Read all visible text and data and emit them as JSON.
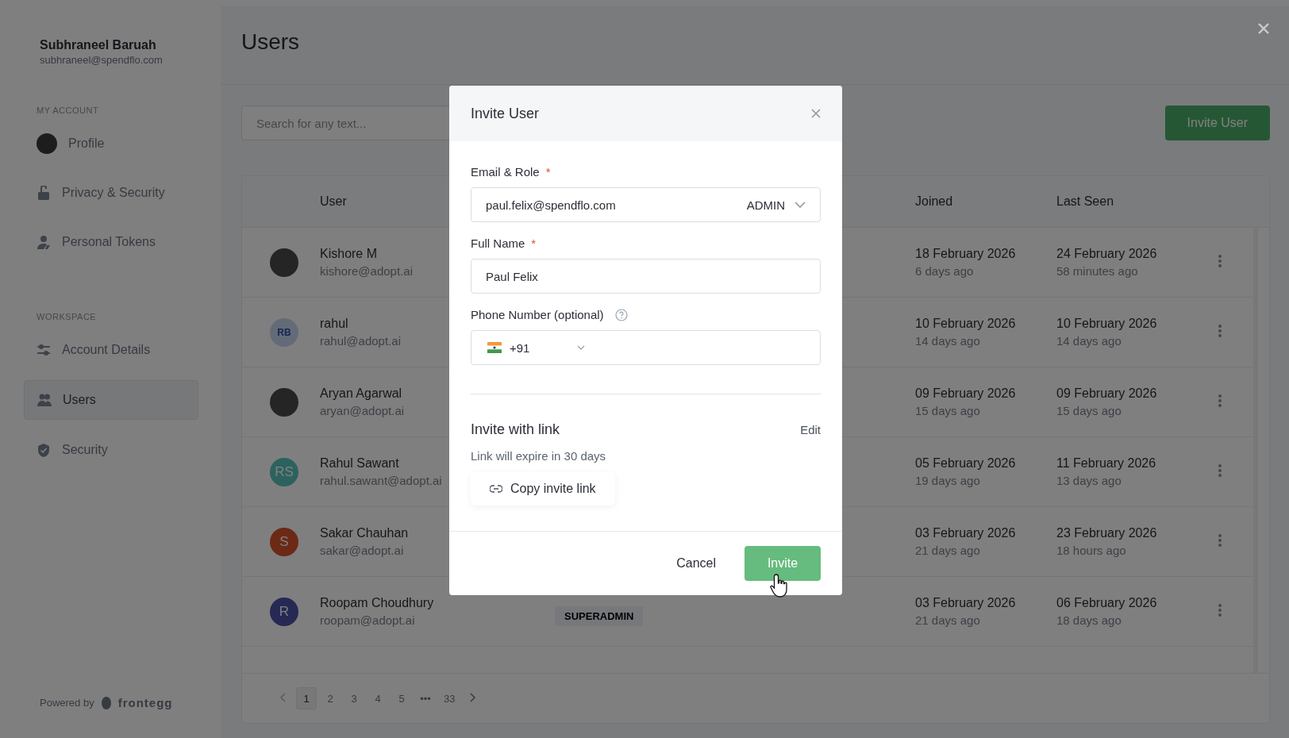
{
  "sidebar": {
    "user_name": "Subhraneel Baruah",
    "user_email": "subhraneel@spendflo.com",
    "sections": [
      {
        "heading": "MY ACCOUNT",
        "items": [
          {
            "label": "Profile",
            "selected": false
          },
          {
            "label": "Privacy & Security",
            "selected": false
          },
          {
            "label": "Personal Tokens",
            "selected": false
          }
        ]
      },
      {
        "heading": "WORKSPACE",
        "items": [
          {
            "label": "Account Details",
            "selected": false
          },
          {
            "label": "Users",
            "selected": true
          },
          {
            "label": "Security",
            "selected": false
          }
        ]
      }
    ],
    "powered_by": "Powered by",
    "brand": "frontegg"
  },
  "page": {
    "title": "Users",
    "search": {
      "placeholder": "Search for any text..."
    },
    "invite_button": "Invite User"
  },
  "table": {
    "columns": [
      "User",
      "Joined",
      "Last Seen"
    ],
    "rows": [
      {
        "name": "Kishore M",
        "email": "kishore@adopt.ai",
        "avatar": {
          "kind": "photo"
        },
        "joined": "18 February 2026",
        "joined_ago": "6 days ago",
        "last_seen": "24 February 2026",
        "last_seen_ago": "58 minutes ago"
      },
      {
        "name": "rahul",
        "email": "rahul@adopt.ai",
        "avatar": {
          "kind": "initials",
          "initials": "RB"
        },
        "joined": "10 February 2026",
        "joined_ago": "14 days ago",
        "last_seen": "10 February 2026",
        "last_seen_ago": "14 days ago"
      },
      {
        "name": "Aryan Agarwal",
        "email": "aryan@adopt.ai",
        "avatar": {
          "kind": "photo"
        },
        "joined": "09 February 2026",
        "joined_ago": "15 days ago",
        "last_seen": "09 February 2026",
        "last_seen_ago": "15 days ago"
      },
      {
        "name": "Rahul Sawant",
        "email": "rahul.sawant@adopt.ai",
        "avatar": {
          "kind": "initials",
          "initials": "RS"
        },
        "joined": "05 February 2026",
        "joined_ago": "19 days ago",
        "last_seen": "11 February 2026",
        "last_seen_ago": "13 days ago"
      },
      {
        "name": "Sakar Chauhan",
        "email": "sakar@adopt.ai",
        "avatar": {
          "kind": "initials",
          "initials": "S"
        },
        "joined": "03 February 2026",
        "joined_ago": "21 days ago",
        "last_seen": "23 February 2026",
        "last_seen_ago": "18 hours ago"
      },
      {
        "name": "Roopam Choudhury",
        "email": "roopam@adopt.ai",
        "avatar": {
          "kind": "initials",
          "initials": "R"
        },
        "role": "SUPERADMIN",
        "joined": "03 February 2026",
        "joined_ago": "21 days ago",
        "last_seen": "06 February 2026",
        "last_seen_ago": "18 days ago"
      }
    ]
  },
  "pagination": {
    "pages": [
      {
        "label": "1",
        "selected": true
      },
      {
        "label": "2",
        "selected": false
      },
      {
        "label": "3",
        "selected": false
      },
      {
        "label": "4",
        "selected": false
      },
      {
        "label": "5",
        "selected": false
      },
      {
        "label": "•••",
        "selected": false
      },
      {
        "label": "33",
        "selected": false
      }
    ]
  },
  "modal": {
    "title": "Invite User",
    "email_field": {
      "label": "Email & Role",
      "required_mark": "*",
      "value": "paul.felix@spendflo.com",
      "role": "ADMIN"
    },
    "name_field": {
      "label": "Full Name",
      "required_mark": "*",
      "value": "Paul Felix"
    },
    "phone_field": {
      "label": "Phone Number (optional)",
      "country_code": "+91"
    },
    "link_section": {
      "title": "Invite with link",
      "edit": "Edit",
      "note": "Link will expire in 30 days",
      "copy_button": "Copy invite link"
    },
    "cancel_button": "Cancel",
    "invite_button": "Invite"
  }
}
